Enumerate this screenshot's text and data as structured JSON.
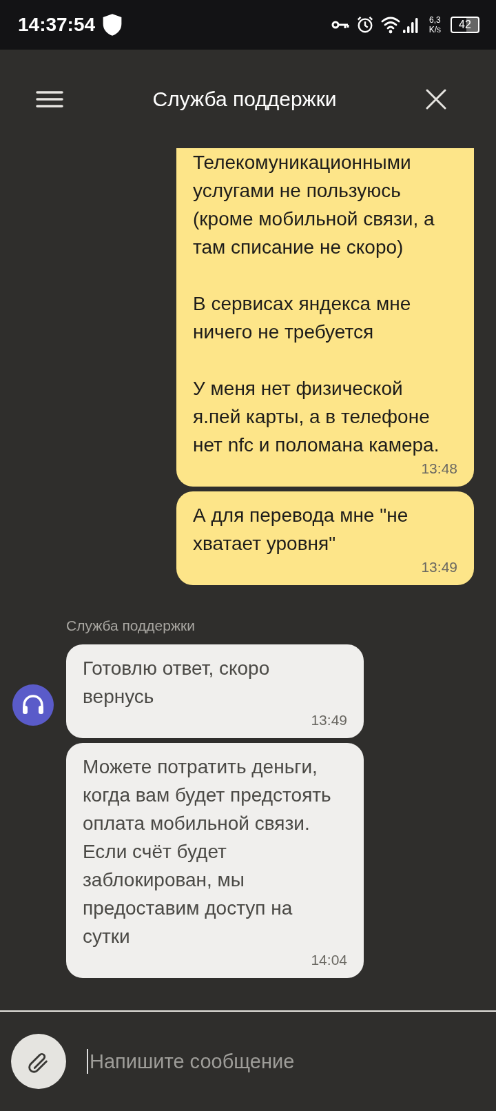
{
  "status_bar": {
    "time": "14:37:54",
    "speed_value": "6,3",
    "speed_unit": "K/s",
    "battery": "42"
  },
  "header": {
    "title": "Служба поддержки"
  },
  "messages": [
    {
      "kind": "outgoing",
      "text": "Телекомуникационными услугами не пользуюсь (кроме мобильной связи, а там списание не скоро)\n\nВ сервисах яндекса мне ничего не требуется\n\nУ меня нет физической я.пей карты, а в телефоне нет nfc и поломана камера.",
      "time": "13:48"
    },
    {
      "kind": "outgoing",
      "text": "А для перевода мне \"не хватает уровня\"",
      "time": "13:49"
    },
    {
      "kind": "sender",
      "text": "Служба поддержки"
    },
    {
      "kind": "incoming",
      "text": "Готовлю ответ, скоро вернусь",
      "time": "13:49",
      "avatar": true
    },
    {
      "kind": "incoming",
      "text": "Можете потратить деньги, когда вам будет предстоять оплата мобильной связи. Если счёт будет заблокирован, мы предоставим доступ на сутки",
      "time": "14:04",
      "avatar": false
    }
  ],
  "composer": {
    "placeholder": "Напишите сообщение"
  }
}
